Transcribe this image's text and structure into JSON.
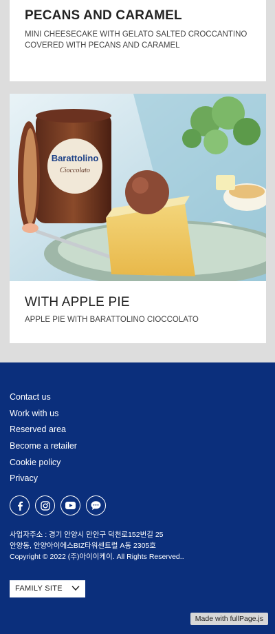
{
  "products": [
    {
      "title": "PECANS AND CARAMEL",
      "description": "MINI CHEESECAKE WITH GELATO SALTED CROCCANTINO COVERED WITH PECANS AND CARAMEL"
    },
    {
      "title": "WITH APPLE PIE",
      "description": "APPLE PIE WITH BARATTOLINO CIOCCOLATO",
      "image": {
        "jar_brand": "Barattolino",
        "jar_flavor": "Cioccolato"
      }
    }
  ],
  "footer": {
    "links": [
      "Contact us",
      "Work with us",
      "Reserved area",
      "Become a retailer",
      "Cookie policy",
      "Privacy"
    ],
    "social_icons": [
      "facebook-icon",
      "instagram-icon",
      "youtube-icon",
      "chat-icon"
    ],
    "address_line1": "사업자주소 : 경기 안양시 만안구 덕천로152번길 25",
    "address_line2": "안양동, 안양아이에스BIZ타워센트럴 A동 2305호",
    "copyright": "Copyright © 2022 (주)아이이케이. All Rights Reserved..",
    "family_site_label": "FAMILY SITE",
    "made_with": "Made with fullPage.js"
  },
  "colors": {
    "footer_bg": "#0b2f7c",
    "page_bg": "#dddddd"
  }
}
